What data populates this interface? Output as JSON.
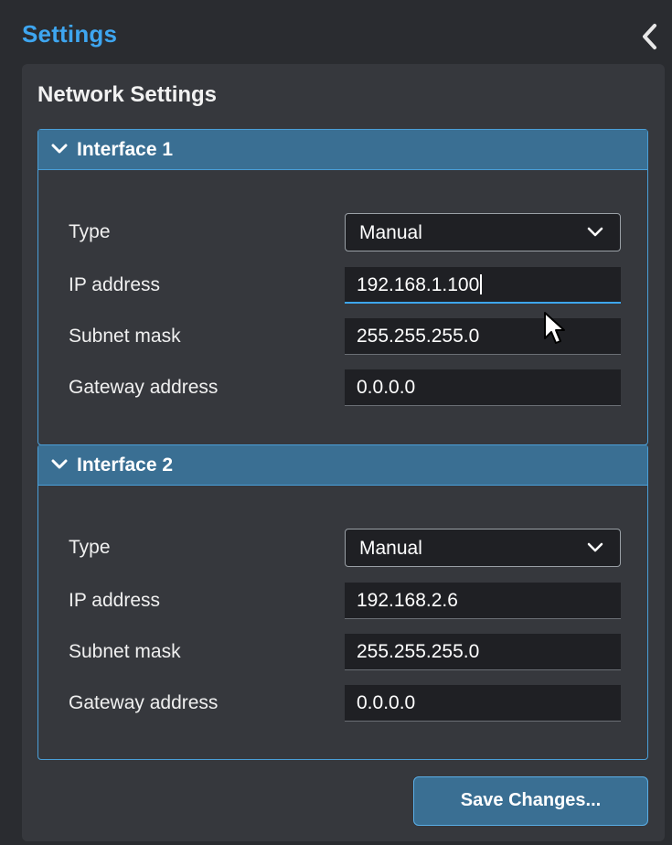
{
  "header": {
    "title": "Settings",
    "collapse_icon": "chevron-left-icon"
  },
  "panel": {
    "title": "Network Settings"
  },
  "interfaces": [
    {
      "header": "Interface 1",
      "type_label": "Type",
      "type_value": "Manual",
      "ip_label": "IP address",
      "ip_value": "192.168.1.100",
      "subnet_label": "Subnet mask",
      "subnet_value": "255.255.255.0",
      "gateway_label": "Gateway address",
      "gateway_value": "0.0.0.0"
    },
    {
      "header": "Interface 2",
      "type_label": "Type",
      "type_value": "Manual",
      "ip_label": "IP address",
      "ip_value": "192.168.2.6",
      "subnet_label": "Subnet mask",
      "subnet_value": "255.255.255.0",
      "gateway_label": "Gateway address",
      "gateway_value": "0.0.0.0"
    }
  ],
  "footer": {
    "save_label": "Save Changes..."
  },
  "colors": {
    "accent": "#3ea6f0",
    "header_bg": "#3a6f93",
    "panel_bg": "#36383d",
    "field_bg": "#1f2024"
  }
}
